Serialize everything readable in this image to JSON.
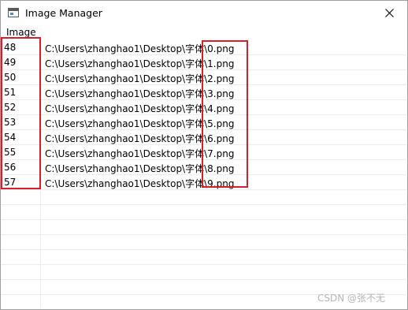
{
  "window": {
    "title": "Image Manager",
    "icon": "app-window-icon",
    "close_icon": "close-icon"
  },
  "menu": {
    "items": [
      "Image"
    ]
  },
  "rows": [
    {
      "id": "48",
      "path": "C:\\Users\\zhanghao1\\Desktop\\字体\\0.png"
    },
    {
      "id": "49",
      "path": "C:\\Users\\zhanghao1\\Desktop\\字体\\1.png"
    },
    {
      "id": "50",
      "path": "C:\\Users\\zhanghao1\\Desktop\\字体\\2.png"
    },
    {
      "id": "51",
      "path": "C:\\Users\\zhanghao1\\Desktop\\字体\\3.png"
    },
    {
      "id": "52",
      "path": "C:\\Users\\zhanghao1\\Desktop\\字体\\4.png"
    },
    {
      "id": "53",
      "path": "C:\\Users\\zhanghao1\\Desktop\\字体\\5.png"
    },
    {
      "id": "54",
      "path": "C:\\Users\\zhanghao1\\Desktop\\字体\\6.png"
    },
    {
      "id": "55",
      "path": "C:\\Users\\zhanghao1\\Desktop\\字体\\7.png"
    },
    {
      "id": "56",
      "path": "C:\\Users\\zhanghao1\\Desktop\\字体\\8.png"
    },
    {
      "id": "57",
      "path": "C:\\Users\\zhanghao1\\Desktop\\字体\\9.png"
    }
  ],
  "empty_rows": 7,
  "colors": {
    "highlight": "#d81e28",
    "grid": "#ececec"
  },
  "watermark": "CSDN @张不无"
}
